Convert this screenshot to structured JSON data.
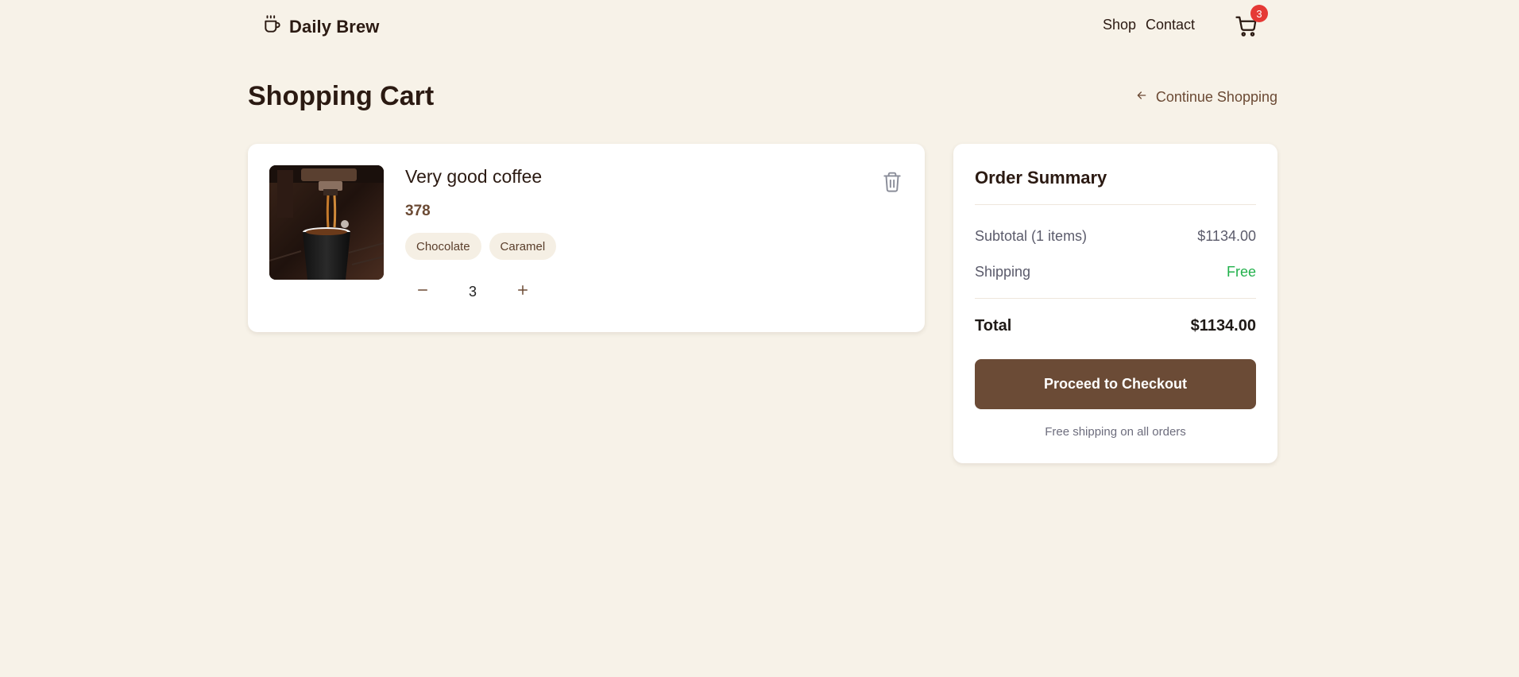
{
  "header": {
    "brand": "Daily Brew",
    "nav": {
      "shop": "Shop",
      "contact": "Contact"
    },
    "cart_count": "3"
  },
  "page": {
    "title": "Shopping Cart",
    "continue_label": "Continue Shopping"
  },
  "cart_items": [
    {
      "name": "Very good coffee",
      "price": "378",
      "tags": [
        "Chocolate",
        "Caramel"
      ],
      "quantity": "3"
    }
  ],
  "summary": {
    "title": "Order Summary",
    "subtotal_label": "Subtotal (1 items)",
    "subtotal_value": "$1134.00",
    "shipping_label": "Shipping",
    "shipping_value": "Free",
    "total_label": "Total",
    "total_value": "$1134.00",
    "checkout_label": "Proceed to Checkout",
    "note": "Free shipping on all orders"
  },
  "colors": {
    "background": "#f7f2e8",
    "accent": "#6b4b36",
    "badge": "#e53935",
    "free": "#22b14c"
  }
}
